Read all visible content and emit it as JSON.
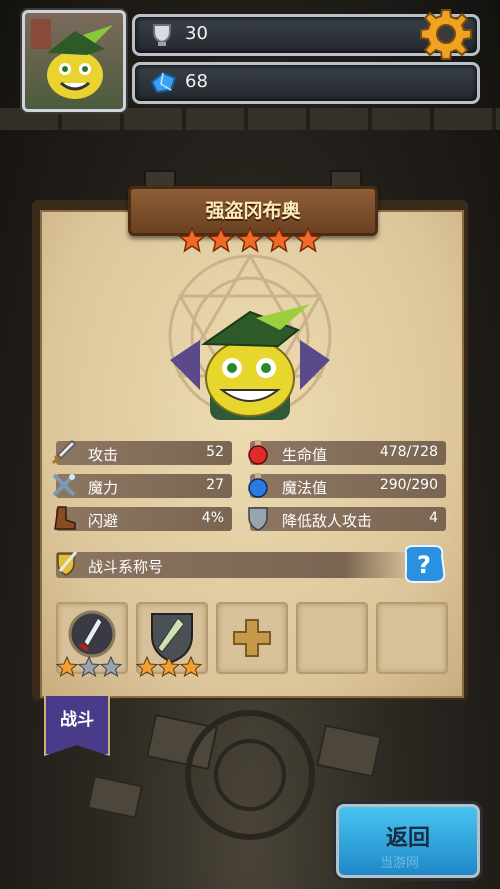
{
  "header": {
    "trophies": "30",
    "gems": "68"
  },
  "hero": {
    "name": "强盗冈布奥",
    "star_rating": 5
  },
  "stats": {
    "attack": {
      "label": "攻击",
      "value": "52"
    },
    "magic": {
      "label": "魔力",
      "value": "27"
    },
    "dodge": {
      "label": "闪避",
      "value": "4%"
    },
    "hp": {
      "label": "生命值",
      "value": "478/728"
    },
    "mp": {
      "label": "魔法值",
      "value": "290/290"
    },
    "reduce_attack": {
      "label": "降低敌人攻击",
      "value": "4"
    }
  },
  "title_bar": {
    "label": "战斗系称号"
  },
  "skills": [
    {
      "icon": "dagger-skill-icon",
      "stars": 1,
      "max_stars": 3
    },
    {
      "icon": "spear-skill-icon",
      "stars": 3,
      "max_stars": 3
    }
  ],
  "tabs": {
    "battle": "战斗"
  },
  "buttons": {
    "back": "返回"
  },
  "watermark": "当游网",
  "colors": {
    "gold_star": "#f0a030",
    "gray_star": "#9aa4ac",
    "back_button": "#2aa8e6",
    "battle_tab": "#4a3a8a"
  }
}
